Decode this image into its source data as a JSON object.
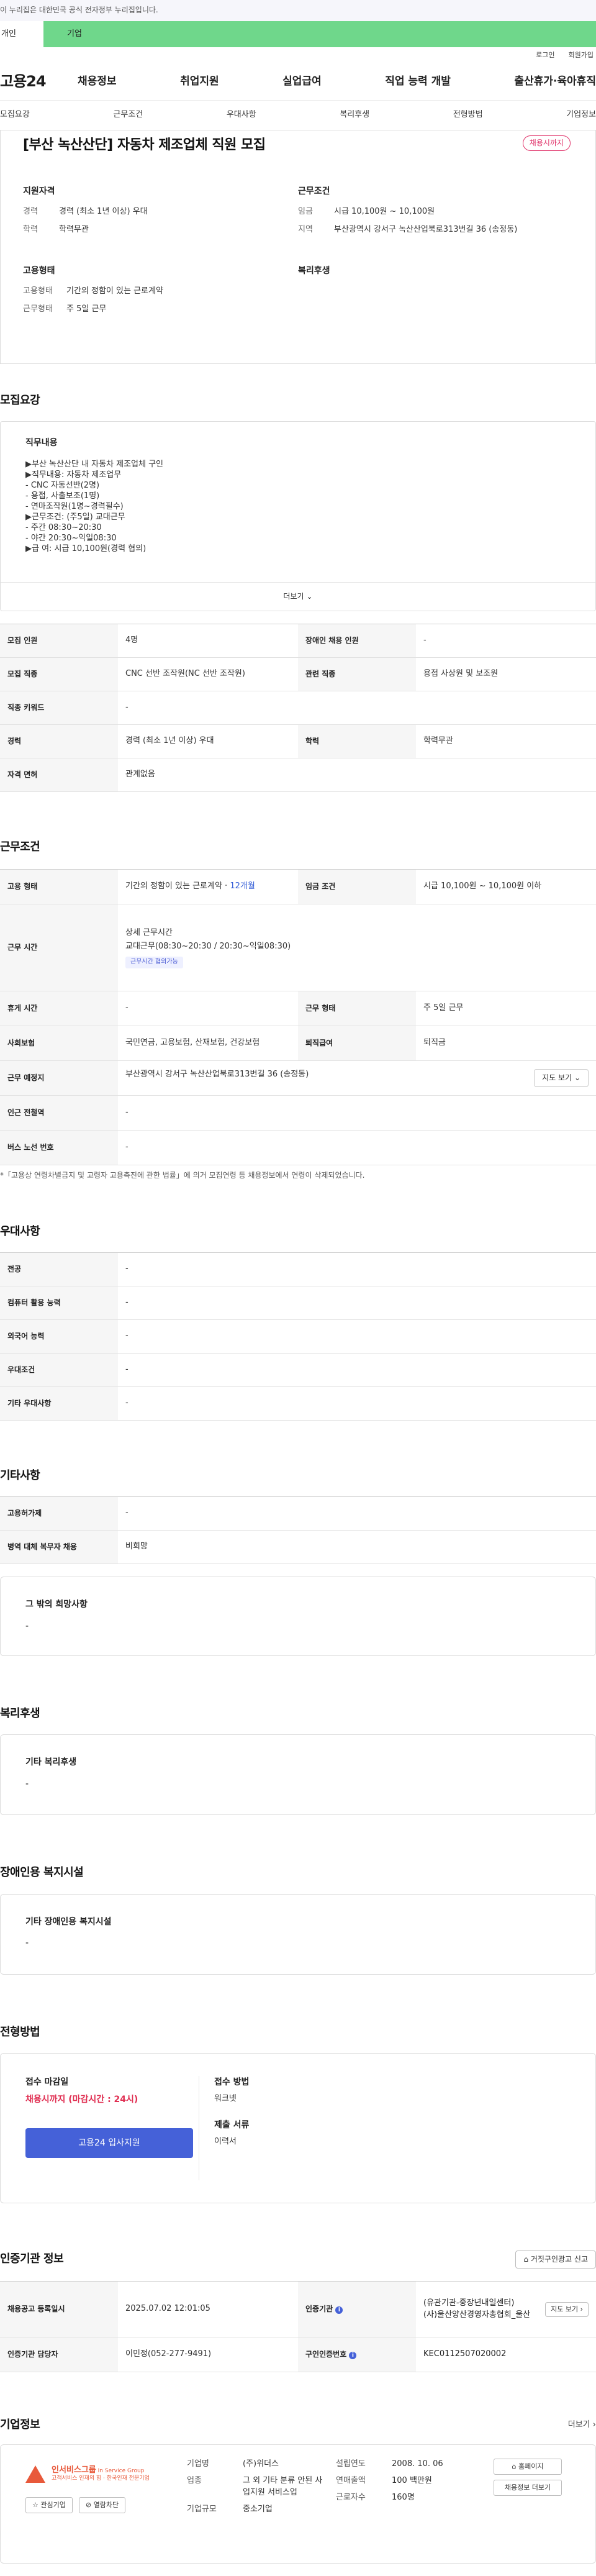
{
  "gov_banner": "이 누리집은 대한민국 공식 전자정부 누리집입니다.",
  "greenbar": {
    "personal": "개인",
    "company": "기업"
  },
  "toplinks": {
    "login": "로그인",
    "signup": "회원가입"
  },
  "gnb": {
    "logo": "고용24",
    "menu": [
      "채용정보",
      "취업지원",
      "실업급여",
      "직업 능력 개발",
      "출산휴가·육아휴직"
    ]
  },
  "tabs": [
    "모집요강",
    "근무조건",
    "우대사항",
    "복리후생",
    "전형방법",
    "기업정보"
  ],
  "hero": {
    "title": "[부산 녹산산단] 자동차 제조업체 직원 모집",
    "badge": "채용시까지",
    "qual_title": "지원자격",
    "qual": [
      {
        "k": "경력",
        "v": "경력 (최소 1년 이상) 우대"
      },
      {
        "k": "학력",
        "v": "학력무관"
      }
    ],
    "cond_title": "근무조건",
    "cond": [
      {
        "k": "임금",
        "v": "시급 10,100원 ~ 10,100원"
      },
      {
        "k": "지역",
        "v": "부산광역시 강서구 녹산산업북로313번길 36 (송정동)"
      }
    ],
    "emp_title": "고용형태",
    "emp": [
      {
        "k": "고용형태",
        "v": "기간의 정함이 있는 근로계약"
      },
      {
        "k": "근무형태",
        "v": "주 5일 근무"
      }
    ],
    "welfare_title": "복리후생"
  },
  "recruit": {
    "section": "모집요강",
    "job_title": "직무내용",
    "lines": [
      "▶부산 녹산산단 내 자동차 제조업체 구인",
      "▶직무내용: 자동차 제조업무",
      "- CNC 자동선반(2명)",
      "- 용접, 사출보조(1명)",
      "- 연마조작원(1명~경력필수)",
      "▶근무조건: (주5일) 교대근무",
      "- 주간 08:30~20:30",
      "- 야간 20:30~익일08:30",
      "▶급      여:  시급 10,100원(경력 협의)"
    ],
    "more": "더보기",
    "rows": [
      [
        {
          "h": "모집 인원",
          "v": "4명"
        },
        {
          "h": "장애인 채용 인원",
          "v": "-"
        }
      ],
      [
        {
          "h": "모집 직종",
          "v": "CNC 선반 조작원(NC 선반 조작원)"
        },
        {
          "h": "관련 직종",
          "v": "용접 사상원 및 보조원"
        }
      ],
      [
        {
          "h": "직종 키워드",
          "v": "-"
        }
      ],
      [
        {
          "h": "경력",
          "v": "경력 (최소 1년 이상) 우대"
        },
        {
          "h": "학력",
          "v": "학력무관"
        }
      ],
      [
        {
          "h": "자격 면허",
          "v": "관계없음"
        }
      ]
    ]
  },
  "work": {
    "section": "근무조건",
    "emp_type_h": "고용 형태",
    "emp_type_v": "기간의 정함이 있는 근로계약",
    "emp_type_months": "12개월",
    "wage_h": "임금 조건",
    "wage_v": "시급 10,100원 ~ 10,100원 이하",
    "hours_h": "근무 시간",
    "hours_title": "상세 근무시간",
    "hours_v": "교대근무(08:30~20:30 / 20:30~익일08:30)",
    "hours_chip": "근무시간 협의가능",
    "rows": [
      [
        {
          "h": "휴게 시간",
          "v": "-"
        },
        {
          "h": "근무 형태",
          "v": "주 5일 근무"
        }
      ],
      [
        {
          "h": "사회보험",
          "v": "국민연금, 고용보험, 산재보험, 건강보험"
        },
        {
          "h": "퇴직급여",
          "v": "퇴직금"
        }
      ]
    ],
    "place_h": "근무 예정지",
    "place_v": "부산광역시 강서구 녹산산업북로313번길 36 (송정동)",
    "map_btn": "지도 보기",
    "station_h": "인근 전철역",
    "station_v": "-",
    "bus_h": "버스 노선 번호",
    "bus_v": "-",
    "note": "*「고용상 연령차별금지 및 고령자 고용촉진에 관한 법률」에 의거 모집연령 등 채용정보에서 연령이 삭제되었습니다."
  },
  "pref": {
    "section": "우대사항",
    "rows": [
      {
        "h": "전공",
        "v": "-"
      },
      {
        "h": "컴퓨터 활용 능력",
        "v": "-"
      },
      {
        "h": "외국어 능력",
        "v": "-"
      },
      {
        "h": "우대조건",
        "v": "-"
      },
      {
        "h": "기타 우대사항",
        "v": "-"
      }
    ]
  },
  "other": {
    "section": "기타사항",
    "rows": [
      {
        "h": "고용허가제",
        "v": "-"
      },
      {
        "h": "병역 대체 복무자 채용",
        "v": "비희망"
      }
    ],
    "card_title": "그 밖의 희망사항",
    "card_v": "-"
  },
  "welfare": {
    "section": "복리후생",
    "card_title": "기타 복리후생",
    "card_v": "-"
  },
  "disab": {
    "section": "장애인용 복지시설",
    "card_title": "기타 장애인용 복지시설",
    "card_v": "-"
  },
  "apply": {
    "section": "전형방법",
    "deadline_label": "접수 마감일",
    "deadline_v": "채용시까지 (마감시간 : 24시)",
    "apply_btn": "고용24 입사지원",
    "method_label": "접수 방법",
    "method_v": "워크넷",
    "docs_label": "제출 서류",
    "docs_v": "이력서"
  },
  "agency": {
    "section": "인증기관 정보",
    "report_btn": "거짓구인광고 신고",
    "reg_h": "채용공고 등록일시",
    "reg_v": "2025.07.02 12:01:05",
    "agency_h": "인증기관",
    "agency_v1": "(유관기관-중장년내일센터)",
    "agency_v2": "(사)울산양산경영자총협회_울산",
    "map_btn": "지도 보기",
    "mgr_h": "인증기관 담당자",
    "mgr_v": "이민정(052-277-9491)",
    "id_h": "구인인증번호",
    "id_v": "KEC0112507020002"
  },
  "company": {
    "section": "기업정보",
    "more": "더보기",
    "logo_name": "인서비스그룹",
    "logo_sub1": "In Service Group",
    "logo_sub2": "고객서비스 인재의 힘 · 한국인재 전문기업",
    "fav_btn": "관심기업",
    "block_btn": "열람차단",
    "name_k": "기업명",
    "name_v": "(주)위더스",
    "ind_k": "업종",
    "ind_v": "그 외 기타 분류 안된 사업지원 서비스업",
    "size_k": "기업규모",
    "size_v": "중소기업",
    "year_k": "설립연도",
    "year_v": "2008. 10. 06",
    "sales_k": "연매출액",
    "sales_v": "100 백만원",
    "emp_k": "근로자수",
    "emp_v": "160명",
    "home_btn": "홈페이지",
    "jobs_btn": "채용정보 더보기"
  }
}
